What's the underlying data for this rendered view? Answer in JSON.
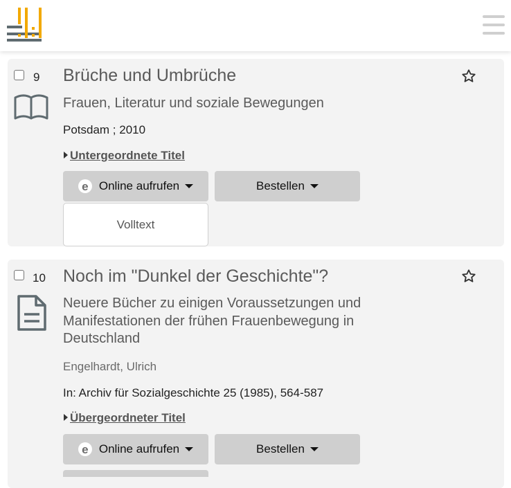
{
  "header": {
    "logo_icon": "library-logo-icon",
    "menu_icon": "hamburger-menu-icon"
  },
  "colors": {
    "logo_gold": "#f2a900",
    "logo_gray": "#5f6b70",
    "card_bg": "#f3f3f3",
    "button_bg": "#cfcfcf",
    "title_text": "#5a5a5a"
  },
  "results": [
    {
      "number": "9",
      "type_icon": "book-icon",
      "title": "Brüche und Umbrüche",
      "subtitle": "Frauen, Literatur und soziale Bewegungen",
      "publication": "Potsdam ; 2010",
      "related_link": "Untergeordnete Titel",
      "online_button": "Online aufrufen",
      "order_button": "Bestellen",
      "fulltext_button": "Volltext"
    },
    {
      "number": "10",
      "type_icon": "article-document-icon",
      "title": "Noch im \"Dunkel der Geschichte\"?",
      "subtitle_lines": [
        "Neuere Bücher zu einigen Voraussetzungen und",
        "Manifestationen der frühen Frauenbewegung in",
        "Deutschland"
      ],
      "author": "Engelhardt, Ulrich",
      "publication": "In: Archiv für Sozialgeschichte 25 (1985), 564-587",
      "related_link": "Übergeordneter Titel",
      "online_button": "Online aufrufen",
      "order_button": "Bestellen"
    }
  ]
}
